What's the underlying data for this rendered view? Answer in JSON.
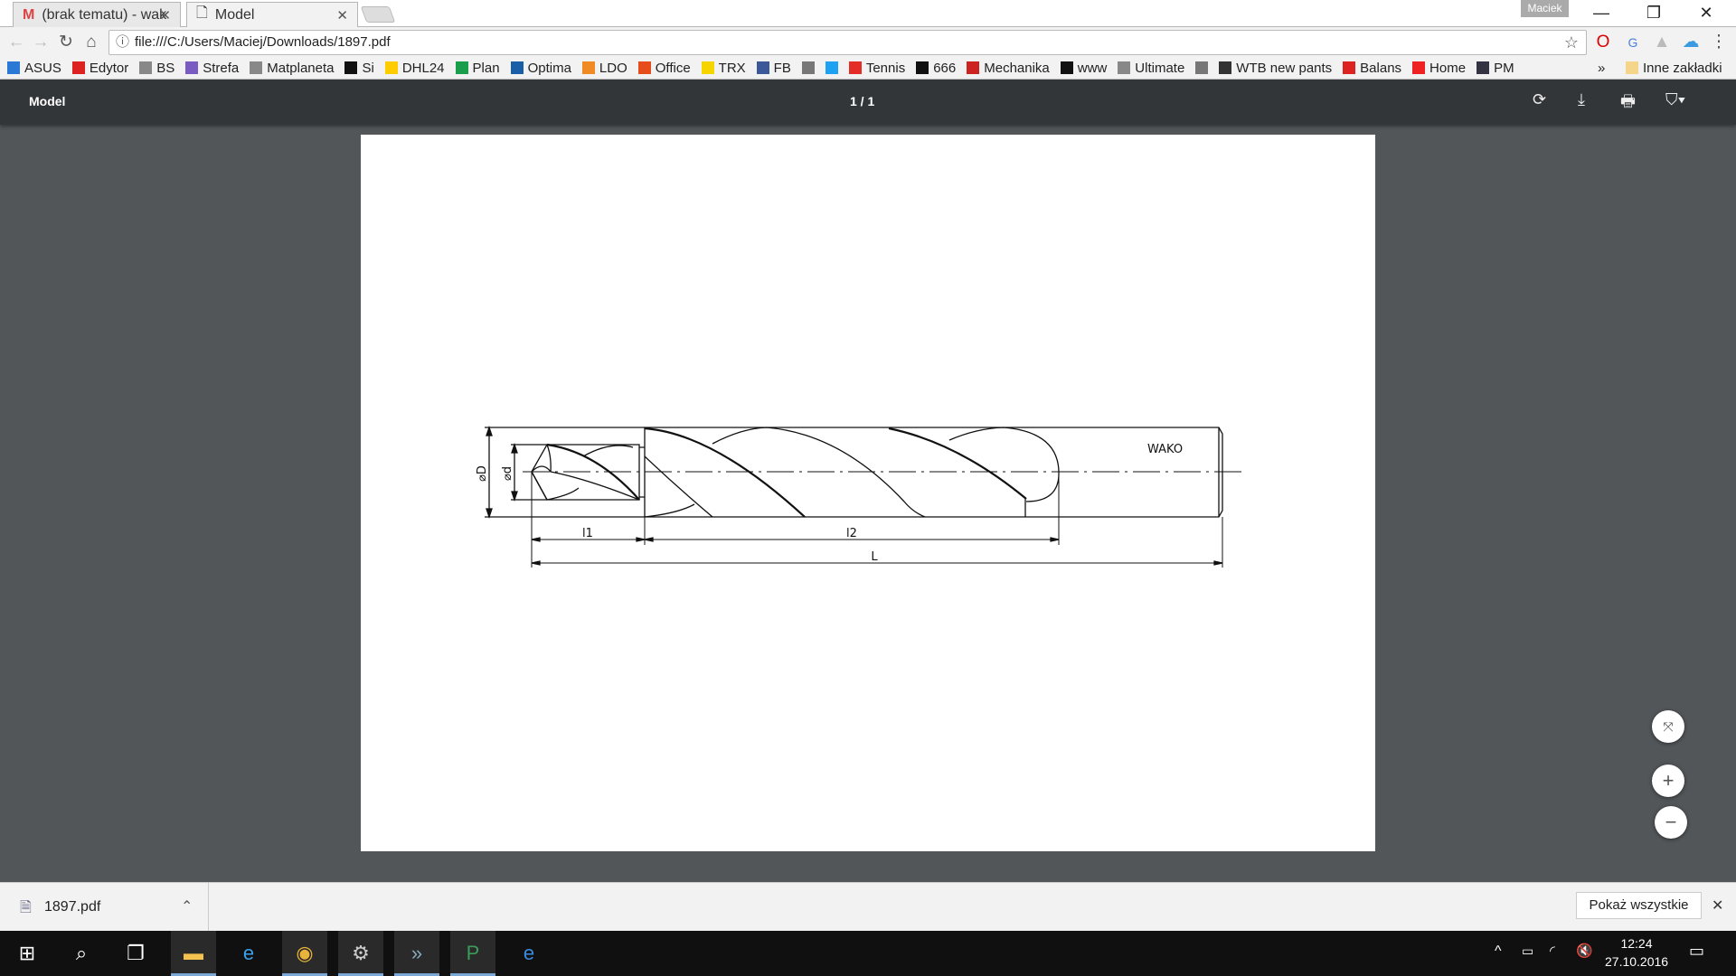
{
  "browser": {
    "tabs": [
      {
        "label": "(brak tematu) - wak",
        "icon": "gmail-icon"
      },
      {
        "label": "Model",
        "icon": "page-icon"
      }
    ],
    "profile": "Maciek",
    "url": "file:///C:/Users/Maciej/Downloads/1897.pdf",
    "bookmarks": [
      {
        "label": "ASUS",
        "icon": "((o",
        "color": "#2a7ad5"
      },
      {
        "label": "Edytor",
        "icon": "✎",
        "color": "#d22"
      },
      {
        "label": "BS",
        "icon": "▯",
        "color": "#888"
      },
      {
        "label": "Strefa",
        "icon": "●",
        "color": "#7a5bc2"
      },
      {
        "label": "Matplaneta",
        "icon": "▯",
        "color": "#888"
      },
      {
        "label": "Si",
        "icon": "SI",
        "color": "#111"
      },
      {
        "label": "DHL24",
        "icon": "▬",
        "color": "#fc0"
      },
      {
        "label": "Plan",
        "icon": "▦",
        "color": "#1b9e4b"
      },
      {
        "label": "Optima",
        "icon": "CA",
        "color": "#1a5ea8"
      },
      {
        "label": "LDO",
        "icon": "✺",
        "color": "#f08a24"
      },
      {
        "label": "Office",
        "icon": "■",
        "color": "#e74c1c"
      },
      {
        "label": "TRX",
        "icon": "▬",
        "color": "#f5d400"
      },
      {
        "label": "FB",
        "icon": "f",
        "color": "#3b5998"
      },
      {
        "label": "",
        "icon": "",
        "color": "#777"
      },
      {
        "label": "",
        "icon": "🐦",
        "color": "#1da1f2"
      },
      {
        "label": "Tennis",
        "icon": "▶",
        "color": "#e52d27"
      },
      {
        "label": "666",
        "icon": "☰",
        "color": "#111"
      },
      {
        "label": "Mechanika",
        "icon": "R",
        "color": "#c22"
      },
      {
        "label": "www",
        "icon": "◆",
        "color": "#111"
      },
      {
        "label": "Ultimate",
        "icon": "▯",
        "color": "#888"
      },
      {
        "label": "",
        "icon": "",
        "color": "#777"
      },
      {
        "label": "WTB new pants",
        "icon": "▬",
        "color": "#333"
      },
      {
        "label": "Balans",
        "icon": "ego",
        "color": "#d22"
      },
      {
        "label": "Home",
        "icon": "✿",
        "color": "#e22"
      },
      {
        "label": "PM",
        "icon": "◉",
        "color": "#334"
      }
    ],
    "bookmarks_more": "»",
    "other_bookmarks": "Inne zakładki"
  },
  "pdf": {
    "title": "Model",
    "page_indicator": "1 / 1",
    "drawing": {
      "label_D": "⌀D",
      "label_d": "⌀d",
      "label_l1": "l1",
      "label_l2": "l2",
      "label_L": "L",
      "brand": "WAKO"
    }
  },
  "downloads": {
    "file": "1897.pdf",
    "show_all": "Pokaż wszystkie"
  },
  "taskbar": {
    "time": "12:24",
    "date": "27.10.2016"
  }
}
